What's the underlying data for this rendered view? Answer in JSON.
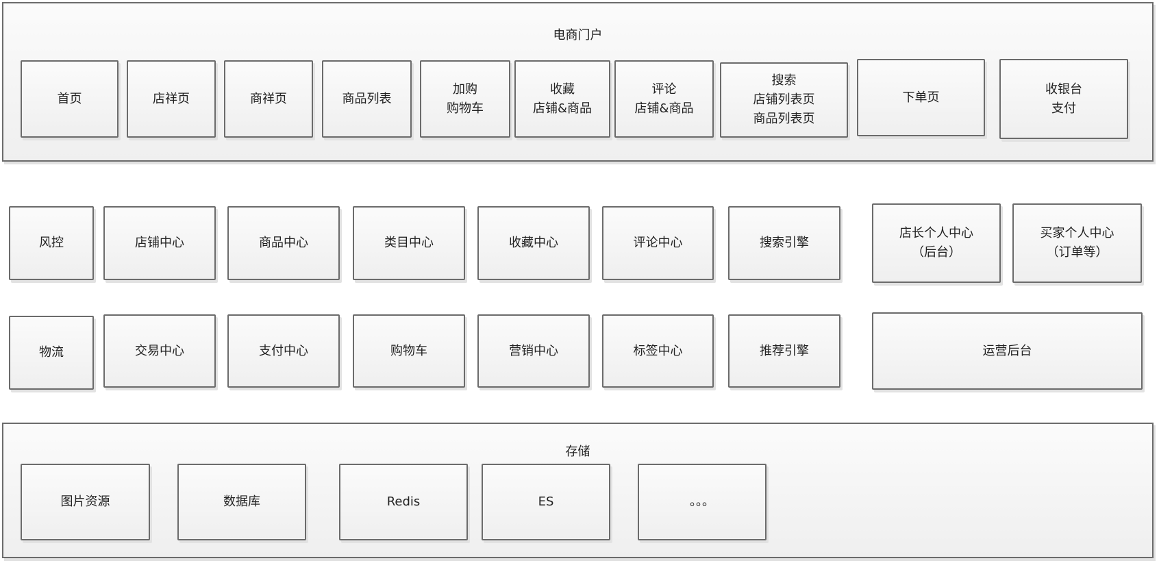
{
  "portal": {
    "title": "电商门户",
    "items": [
      "首页",
      "店祥页",
      "商祥页",
      "商品列表",
      "加购\n购物车",
      "收藏\n店铺&商品",
      "评论\n店铺&商品",
      "搜索\n店铺列表页\n商品列表页",
      "下单页",
      "收银台\n支付"
    ]
  },
  "services": {
    "row1": [
      "风控",
      "店铺中心",
      "商品中心",
      "类目中心",
      "收藏中心",
      "评论中心",
      "搜索引擎"
    ],
    "row2": [
      "物流",
      "交易中心",
      "支付中心",
      "购物车",
      "营销中心",
      "标签中心",
      "推荐引擎"
    ],
    "side": [
      "店长个人中心\n（后台）",
      "买家个人中心\n（订单等）",
      "运营后台"
    ]
  },
  "storage": {
    "title": "存储",
    "items": [
      "图片资源",
      "数据库",
      "Redis",
      "ES",
      "。。。"
    ]
  }
}
